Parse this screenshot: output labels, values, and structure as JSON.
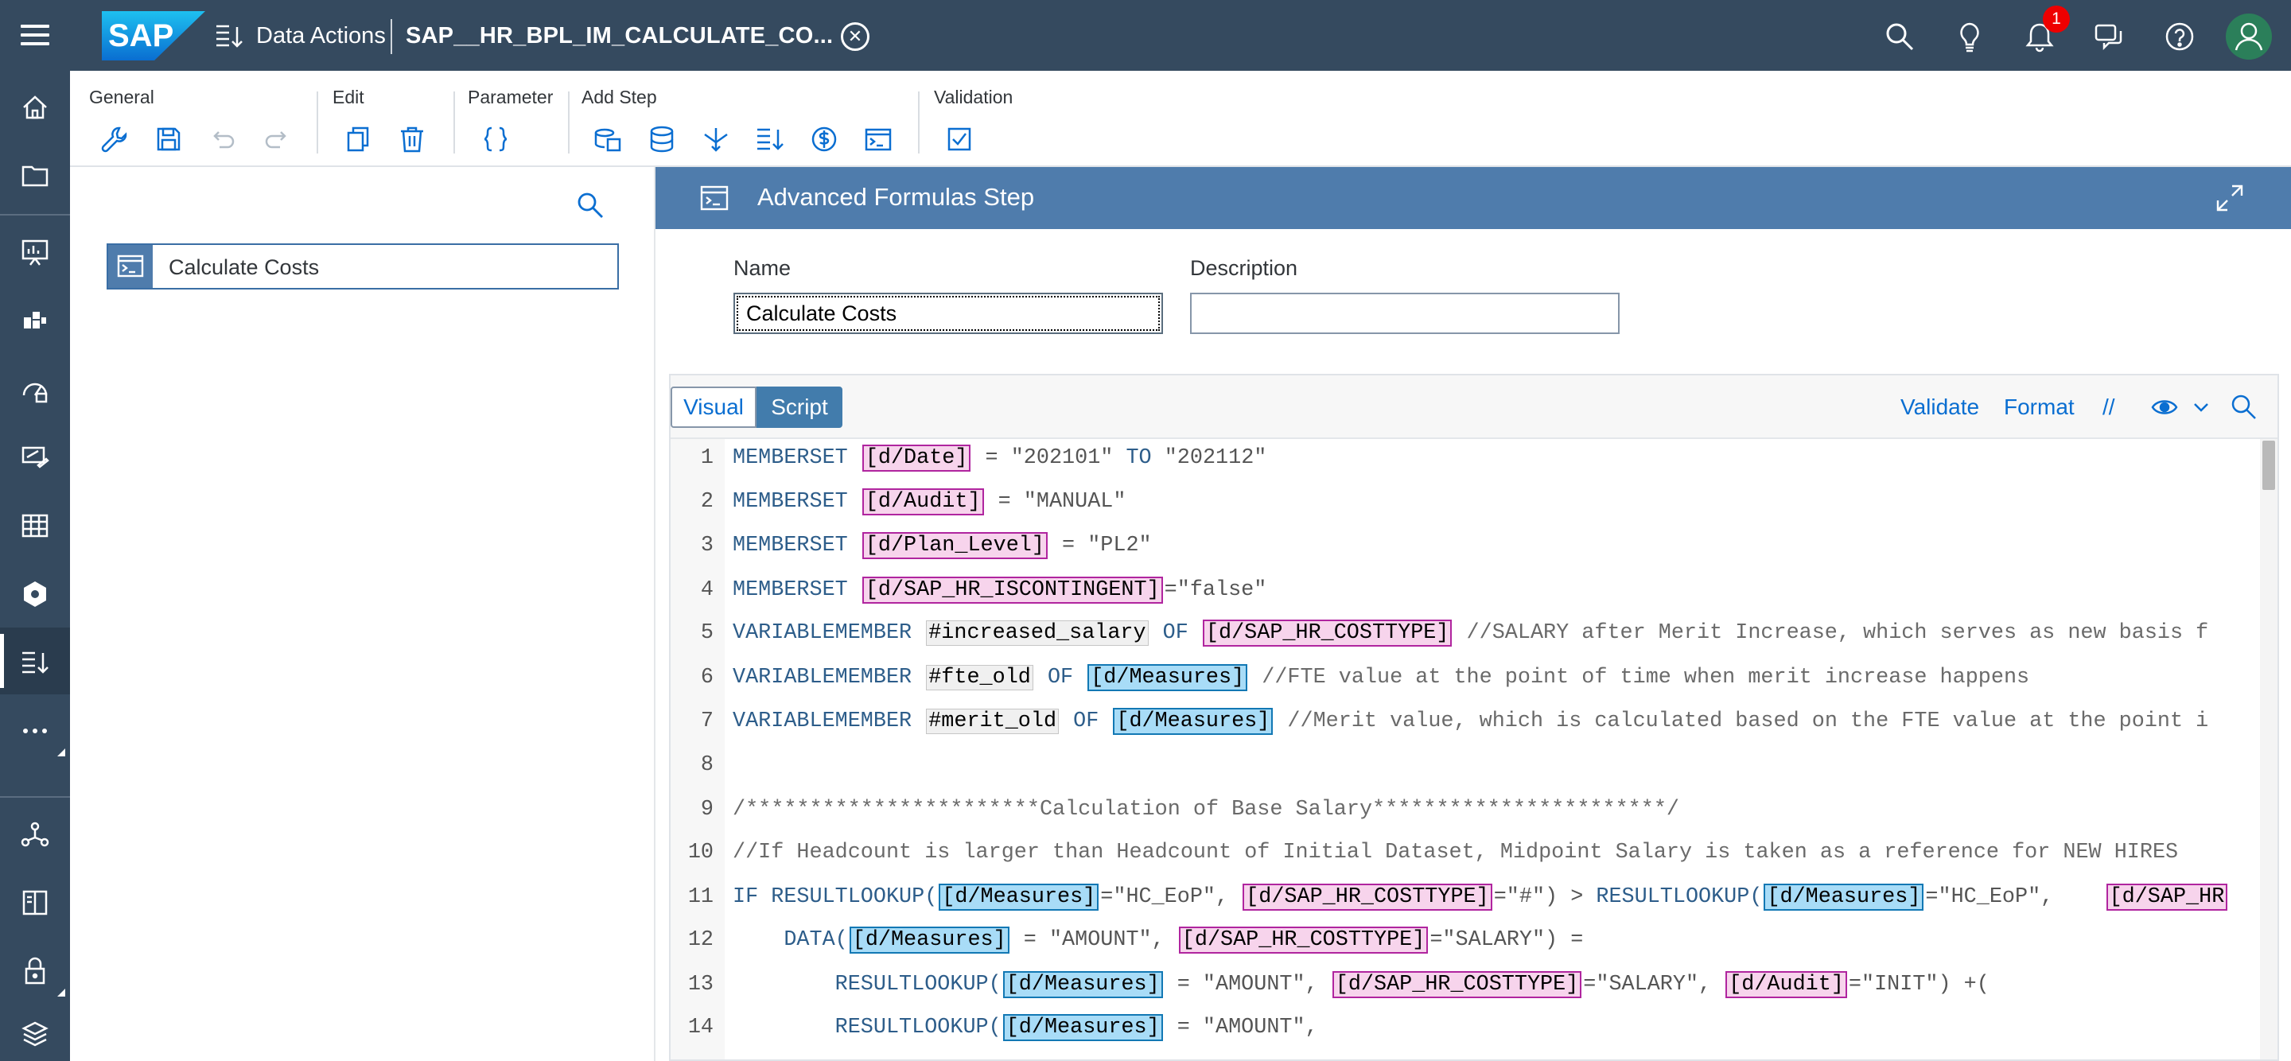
{
  "shell": {
    "app_name": "Data Actions",
    "data_action_title": "SAP__HR_BPL_IM_CALCULATE_CO...",
    "notifications_count": "1",
    "logo_text": "SAP"
  },
  "leftnav": {
    "items": [
      "home-icon",
      "files-icon",
      "stories-icon",
      "analytic-app-icon",
      "digital-boardroom-icon",
      "modeler-icon",
      "dimensions-icon",
      "settings-icon",
      "data-actions-icon",
      "more-icon",
      "connections-icon",
      "catalog-icon",
      "security-icon",
      "deployment-icon"
    ]
  },
  "toolbar": {
    "groups": {
      "general": "General",
      "edit": "Edit",
      "parameter": "Parameter",
      "add_step": "Add Step",
      "validation": "Validation"
    }
  },
  "left_panel": {
    "steps": [
      {
        "label": "Calculate Costs"
      }
    ]
  },
  "step_panel": {
    "title": "Advanced Formulas Step",
    "name_label": "Name",
    "name_value": "Calculate Costs",
    "description_label": "Description",
    "description_value": ""
  },
  "editor": {
    "tabs": {
      "visual": "Visual",
      "script": "Script"
    },
    "validate": "Validate",
    "format": "Format",
    "comment_toggle": "//",
    "lines": [
      {
        "n": "1",
        "parts": [
          {
            "t": "kw",
            "v": "MEMBERSET "
          },
          {
            "t": "dpink",
            "v": "[d/Date]"
          },
          {
            "t": "str",
            "v": " = \"202101\" "
          },
          {
            "t": "kw",
            "v": "TO"
          },
          {
            "t": "str",
            "v": " \"202112\""
          }
        ]
      },
      {
        "n": "2",
        "parts": [
          {
            "t": "kw",
            "v": "MEMBERSET "
          },
          {
            "t": "dpink",
            "v": "[d/Audit]"
          },
          {
            "t": "str",
            "v": " = \"MANUAL\""
          }
        ]
      },
      {
        "n": "3",
        "parts": [
          {
            "t": "kw",
            "v": "MEMBERSET "
          },
          {
            "t": "dpink",
            "v": "[d/Plan_Level]"
          },
          {
            "t": "str",
            "v": " = \"PL2\""
          }
        ]
      },
      {
        "n": "4",
        "parts": [
          {
            "t": "kw",
            "v": "MEMBERSET "
          },
          {
            "t": "dpink",
            "v": "[d/SAP_HR_ISCONTINGENT]"
          },
          {
            "t": "str",
            "v": "=\"false\""
          }
        ]
      },
      {
        "n": "5",
        "parts": [
          {
            "t": "kw",
            "v": "VARIABLEMEMBER "
          },
          {
            "t": "dvar",
            "v": "#increased_salary"
          },
          {
            "t": "kw",
            "v": " OF "
          },
          {
            "t": "dpink",
            "v": "[d/SAP_HR_COSTTYPE]"
          },
          {
            "t": "cmt",
            "v": " //SALARY after Merit Increase, which serves as new basis f"
          }
        ]
      },
      {
        "n": "6",
        "parts": [
          {
            "t": "kw",
            "v": "VARIABLEMEMBER "
          },
          {
            "t": "dvar",
            "v": "#fte_old"
          },
          {
            "t": "kw",
            "v": " OF "
          },
          {
            "t": "dblue",
            "v": "[d/Measures]"
          },
          {
            "t": "cmt",
            "v": " //FTE value at the point of time when merit increase happens"
          }
        ]
      },
      {
        "n": "7",
        "parts": [
          {
            "t": "kw",
            "v": "VARIABLEMEMBER "
          },
          {
            "t": "dvar",
            "v": "#merit_old"
          },
          {
            "t": "kw",
            "v": " OF "
          },
          {
            "t": "dblue",
            "v": "[d/Measures]"
          },
          {
            "t": "cmt",
            "v": " //Merit value, which is calculated based on the FTE value at the point i"
          }
        ]
      },
      {
        "n": "8",
        "parts": []
      },
      {
        "n": "9",
        "parts": [
          {
            "t": "cmt",
            "v": "/***********************Calculation of Base Salary***********************/"
          }
        ]
      },
      {
        "n": "10",
        "parts": [
          {
            "t": "cmt",
            "v": "//If Headcount is larger than Headcount of Initial Dataset, Midpoint Salary is taken as a reference for NEW HIRES"
          }
        ]
      },
      {
        "n": "11",
        "parts": [
          {
            "t": "kw",
            "v": "IF RESULTLOOKUP("
          },
          {
            "t": "dblue",
            "v": "[d/Measures]"
          },
          {
            "t": "str",
            "v": "=\"HC_EoP\", "
          },
          {
            "t": "dpink",
            "v": "[d/SAP_HR_COSTTYPE]"
          },
          {
            "t": "str",
            "v": "=\"#\") > "
          },
          {
            "t": "kw",
            "v": "RESULTLOOKUP("
          },
          {
            "t": "dblue",
            "v": "[d/Measures]"
          },
          {
            "t": "str",
            "v": "=\"HC_EoP\",    "
          },
          {
            "t": "dpink",
            "v": "[d/SAP_HR"
          }
        ]
      },
      {
        "n": "12",
        "parts": [
          {
            "t": "kw",
            "v": "    DATA("
          },
          {
            "t": "dblue",
            "v": "[d/Measures]"
          },
          {
            "t": "str",
            "v": " = \"AMOUNT\", "
          },
          {
            "t": "dpink",
            "v": "[d/SAP_HR_COSTTYPE]"
          },
          {
            "t": "str",
            "v": "=\"SALARY\") ="
          }
        ]
      },
      {
        "n": "13",
        "parts": [
          {
            "t": "kw",
            "v": "        RESULTLOOKUP("
          },
          {
            "t": "dblue",
            "v": "[d/Measures]"
          },
          {
            "t": "str",
            "v": " = \"AMOUNT\", "
          },
          {
            "t": "dpink",
            "v": "[d/SAP_HR_COSTTYPE]"
          },
          {
            "t": "str",
            "v": "=\"SALARY\", "
          },
          {
            "t": "dpink",
            "v": "[d/Audit]"
          },
          {
            "t": "str",
            "v": "=\"INIT\") +("
          }
        ]
      },
      {
        "n": "14",
        "parts": [
          {
            "t": "kw",
            "v": "        RESULTLOOKUP("
          },
          {
            "t": "dblue",
            "v": "[d/Measures]"
          },
          {
            "t": "str",
            "v": " = \"AMOUNT\","
          }
        ]
      }
    ]
  },
  "colors": {
    "shell_bg": "#354a5f",
    "panel_header_bg": "#4f7cac",
    "member_pink": "#f7d4ec",
    "member_blue": "#a8dcf7",
    "notification_red": "#ee0000",
    "avatar_green": "#2b7f5a"
  }
}
